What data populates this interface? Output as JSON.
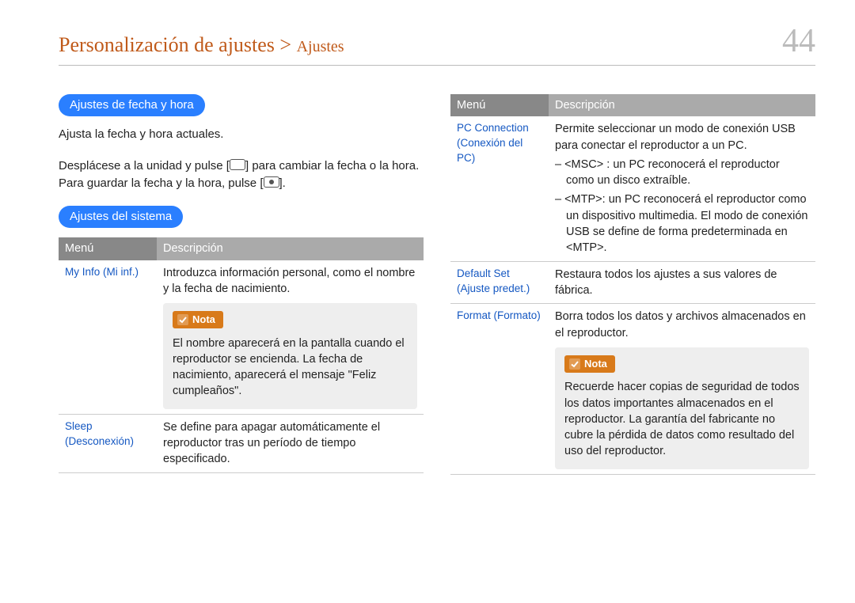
{
  "header": {
    "breadcrumb_main": "Personalización de ajustes >",
    "breadcrumb_sub": "Ajustes",
    "page_number": "44"
  },
  "left": {
    "pill1": "Ajustes de fecha y hora",
    "text1": "Ajusta la fecha y hora actuales.",
    "text2a": "Desplácese a la unidad y pulse [",
    "text2b": "] para cambiar la fecha o la hora. Para guardar la fecha y la hora, pulse [",
    "text2c": "].",
    "pill2": "Ajustes del sistema",
    "table": {
      "head_menu": "Menú",
      "head_desc": "Descripción",
      "rows": [
        {
          "menu": "My Info (Mi inf.)",
          "desc_top": "Introduzca información personal, como el nombre y la fecha de nacimiento.",
          "note_label": "Nota",
          "note_text": "El nombre aparecerá en la pantalla cuando el reproductor se encienda. La fecha de nacimiento, aparecerá el mensaje \"Feliz cumpleaños\"."
        },
        {
          "menu": "Sleep (Desconexión)",
          "desc": "Se define para apagar automáticamente el reproductor tras un período de tiempo especificado."
        }
      ]
    }
  },
  "right": {
    "table": {
      "head_menu": "Menú",
      "head_desc": "Descripción",
      "rows": [
        {
          "menu": "PC Connection (Conexión del PC)",
          "desc_top": "Permite seleccionar un modo de conexión USB para conectar el reproductor a un PC.",
          "bullet1": "– <MSC> : un PC reconocerá el reproductor como un disco extraíble.",
          "bullet2": "– <MTP>: un PC reconocerá el reproductor como un dispositivo multimedia. El modo de conexión USB se define de forma predeterminada en <MTP>."
        },
        {
          "menu": "Default Set (Ajuste predet.)",
          "desc": "Restaura todos los ajustes a sus valores de fábrica."
        },
        {
          "menu": "Format (Formato)",
          "desc_top": "Borra todos los datos y archivos almacenados en el reproductor.",
          "note_label": "Nota",
          "note_text": "Recuerde hacer copias de seguridad de todos los datos importantes almacenados en el reproductor. La garantía del fabricante no cubre la pérdida de datos como resultado del uso del reproductor."
        }
      ]
    }
  }
}
